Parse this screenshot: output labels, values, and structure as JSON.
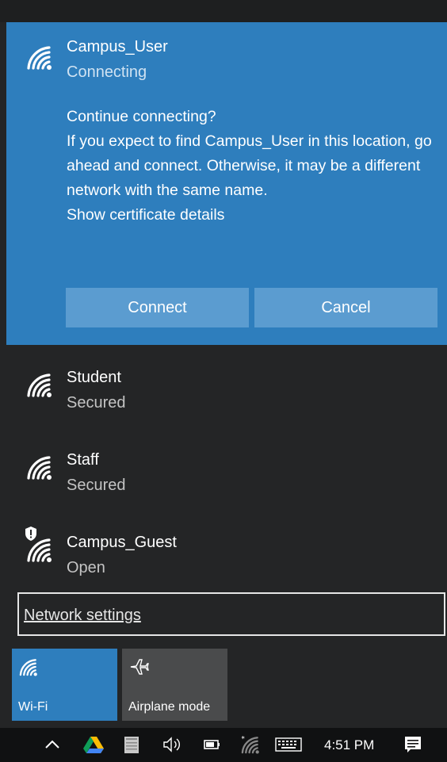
{
  "selected_network": {
    "name": "Campus_User",
    "status": "Connecting",
    "prompt_lines": [
      "Continue connecting?",
      "If you expect to find Campus_User in this location, go ahead and connect. Otherwise, it may be a different network with the same name."
    ],
    "certificate_link": "Show certificate details",
    "connect_label": "Connect",
    "cancel_label": "Cancel"
  },
  "networks": [
    {
      "name": "Student",
      "status": "Secured"
    },
    {
      "name": "Staff",
      "status": "Secured"
    },
    {
      "name": "Campus_Guest",
      "status": "Open"
    }
  ],
  "network_settings_label": "Network settings",
  "quick_actions": [
    {
      "label": "Wi-Fi",
      "icon": "wifi-icon",
      "active": true
    },
    {
      "label": "Airplane mode",
      "icon": "airplane-icon",
      "active": false
    }
  ],
  "taskbar": {
    "time": "4:51 PM",
    "icons": [
      "chevron-up-icon",
      "google-drive-icon",
      "notepad-icon",
      "volume-icon",
      "battery-icon",
      "wifi-icon",
      "keyboard-icon",
      "action-center-icon"
    ]
  },
  "colors": {
    "accent": "#2e7ebd",
    "button": "#5b9cd0",
    "background": "#242526",
    "taskbar": "#101112"
  }
}
